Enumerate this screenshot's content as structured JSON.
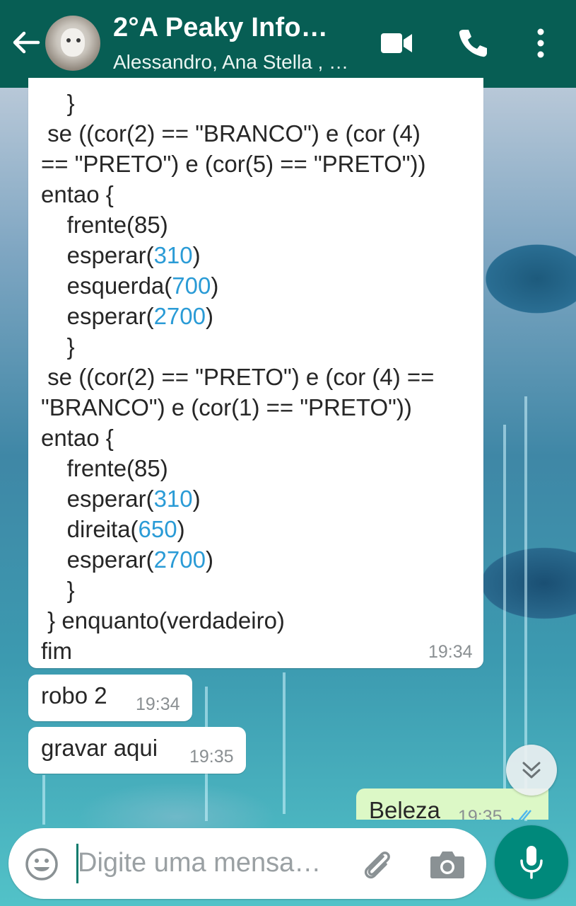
{
  "header": {
    "title": "2°A Peaky Info…",
    "subtitle": "Alessandro, Ana Stella , …",
    "icons": [
      "back-arrow-icon",
      "video-call-icon",
      "phone-icon",
      "more-vert-icon"
    ],
    "color": "#075e54"
  },
  "code_message": {
    "lines": [
      "    }",
      " se ((cor(2) == \"BRANCO\") e (cor (4)",
      "== \"PRETO\") e (cor(5) == \"PRETO\"))",
      "entao {",
      "    frente(85)",
      "    esperar(310)",
      "    esquerda(700)",
      "    esperar(2700)",
      "    }",
      " se ((cor(2) == \"PRETO\") e (cor (4) ==",
      "\"BRANCO\") e (cor(1) == \"PRETO\"))",
      "entao {",
      "    frente(85)",
      "    esperar(310)",
      "    direita(650)",
      "    esperar(2700)",
      "    }",
      " } enquanto(verdadeiro)",
      "fim"
    ],
    "time": "19:34"
  },
  "messages": [
    {
      "text": "robo 2",
      "time": "19:34"
    },
    {
      "text": "gravar aqui",
      "time": "19:35"
    }
  ],
  "outgoing": {
    "text": "Beleza",
    "time": "19:35",
    "color": "#dcf8c6"
  },
  "input": {
    "placeholder": "Digite uma mensa…",
    "icons": [
      "emoji-icon",
      "attach-icon",
      "camera-icon",
      "mic-icon"
    ]
  },
  "accent": "#00897b",
  "link_number_color": "#2a9bd6"
}
